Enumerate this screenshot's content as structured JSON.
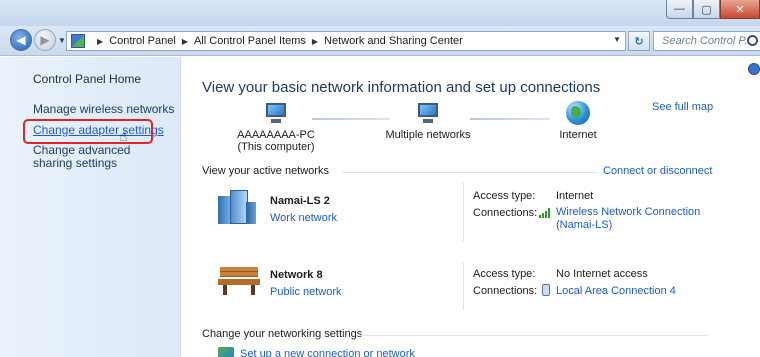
{
  "window": {
    "min_glyph": "—",
    "max_glyph": "▢",
    "close_glyph": "✕"
  },
  "address": {
    "crumbs": [
      "Control Panel",
      "All Control Panel Items",
      "Network and Sharing Center"
    ],
    "search_placeholder": "Search Control P..."
  },
  "sidebar": {
    "home": "Control Panel Home",
    "links": [
      "Manage wireless networks",
      "Change adapter settings",
      "Change advanced sharing settings"
    ]
  },
  "main": {
    "title": "View your basic network information and set up connections",
    "see_full_map": "See full map",
    "map": {
      "computer_name": "AAAAAAAA-PC",
      "computer_sub": "(This computer)",
      "middle": "Multiple networks",
      "internet": "Internet"
    },
    "active_heading": "View your active networks",
    "connect_disconnect": "Connect or disconnect",
    "networks": [
      {
        "name": "Namai-LS  2",
        "type": "Work network",
        "access_key": "Access type:",
        "access_val": "Internet",
        "conn_key": "Connections:",
        "conn_val_line1": "Wireless Network Connection",
        "conn_val_line2": "(Namai-LS)"
      },
      {
        "name": "Network  8",
        "type": "Public network",
        "access_key": "Access type:",
        "access_val": "No Internet access",
        "conn_key": "Connections:",
        "conn_val_line1": "Local Area Connection 4"
      }
    ],
    "change_heading": "Change your networking settings",
    "setup_link": "Set up a new connection or network"
  }
}
